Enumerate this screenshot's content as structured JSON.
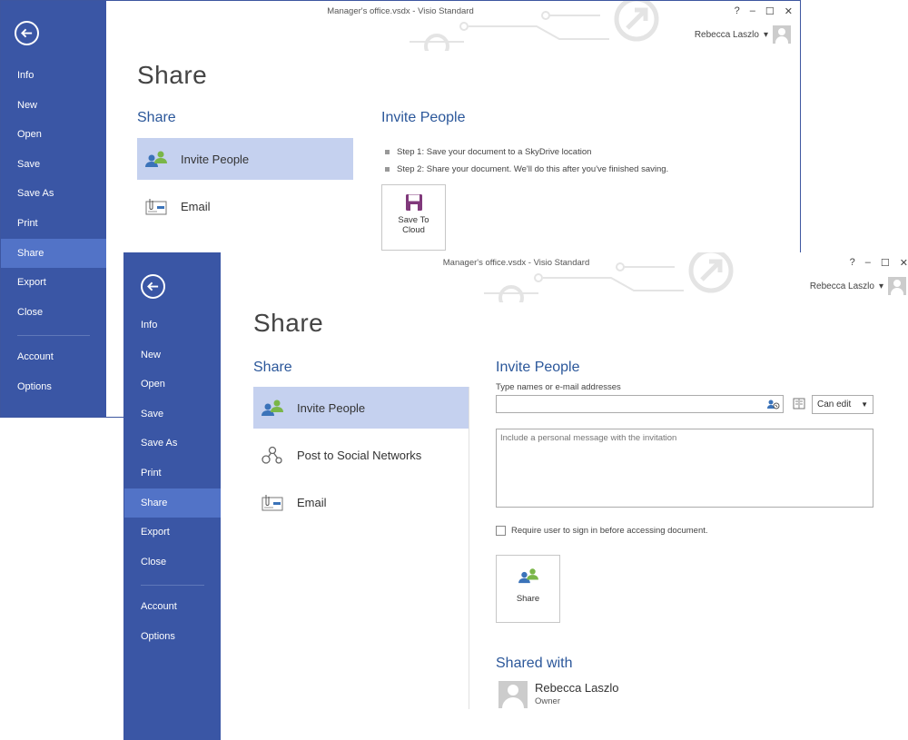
{
  "back_window": {
    "title": "Manager's office.vsdx - Visio Standard",
    "controls": {
      "help": "?",
      "minimize": "–",
      "restore": "☐",
      "close": "✕"
    },
    "user_name": "Rebecca Laszlo",
    "user_caret": "▾",
    "nav": [
      "Info",
      "New",
      "Open",
      "Save",
      "Save As",
      "Print",
      "Share",
      "Export",
      "Close"
    ],
    "nav_bottom": [
      "Account",
      "Options"
    ],
    "page_title": "Share",
    "share_heading": "Share",
    "options": {
      "invite": "Invite People",
      "email": "Email"
    },
    "right_heading": "Invite People",
    "steps": [
      "Step 1: Save your document to a SkyDrive location",
      "Step 2: Share your document. We'll do this after you've finished saving."
    ],
    "save_to_cloud_line1": "Save To",
    "save_to_cloud_line2": "Cloud"
  },
  "front_window": {
    "title": "Manager's office.vsdx - Visio Standard",
    "controls": {
      "help": "?",
      "minimize": "–",
      "restore": "☐",
      "close": "✕"
    },
    "user_name": "Rebecca Laszlo",
    "user_caret": "▾",
    "nav": [
      "Info",
      "New",
      "Open",
      "Save",
      "Save As",
      "Print",
      "Share",
      "Export",
      "Close"
    ],
    "nav_bottom": [
      "Account",
      "Options"
    ],
    "page_title": "Share",
    "share_heading": "Share",
    "options": {
      "invite": "Invite People",
      "social": "Post to Social Networks",
      "email": "Email"
    },
    "right_heading": "Invite People",
    "names_label": "Type names or e-mail addresses",
    "names_value": "",
    "permission": "Can edit",
    "permission_caret": "▼",
    "message_placeholder": "Include a personal message with the invitation",
    "require_signin_label": "Require user to sign in before accessing document.",
    "share_button": "Share",
    "shared_with_heading": "Shared with",
    "shared_user_name": "Rebecca Laszlo",
    "shared_user_role": "Owner"
  },
  "colors": {
    "sidebar": "#3a56a5",
    "sidebar_active": "#5273c7",
    "accent": "#2b579a",
    "option_active": "#c5d1ef"
  },
  "icons": [
    "back-arrow-icon",
    "invite-people-icon",
    "email-icon",
    "social-network-icon",
    "floppy-disk-icon",
    "address-book-icon",
    "check-names-icon",
    "user-avatar-icon"
  ]
}
